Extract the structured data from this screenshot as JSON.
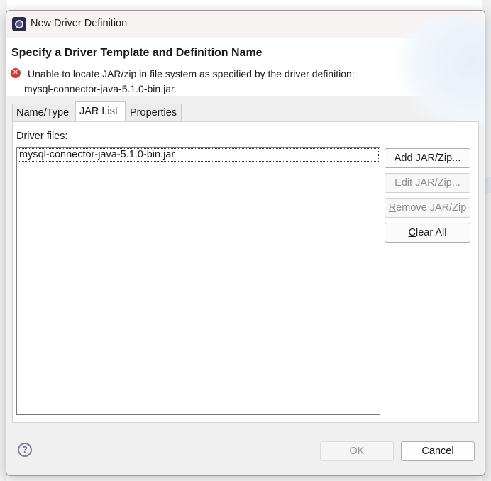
{
  "dialog": {
    "title": "New Driver Definition",
    "close_glyph": "✕",
    "icon": "eclipse-app-icon"
  },
  "header": {
    "title": "Specify a Driver Template and Definition Name",
    "error_icon": "error-x-icon",
    "error_line1": "Unable to locate JAR/zip in file system as specified by the driver definition:",
    "error_line2": "mysql-connector-java-5.1.0-bin.jar."
  },
  "tabs": [
    {
      "label": "Name/Type",
      "active": false
    },
    {
      "label": "JAR List",
      "active": true
    },
    {
      "label": "Properties",
      "active": false
    }
  ],
  "jar_list": {
    "files_label_pre": "Driver ",
    "files_label_mnemonic": "f",
    "files_label_post": "iles:",
    "files": [
      "mysql-connector-java-5.1.0-bin.jar"
    ]
  },
  "buttons": {
    "add": {
      "mn": "A",
      "rest": "dd JAR/Zip...",
      "enabled": true
    },
    "edit": {
      "mn": "E",
      "rest": "dit JAR/Zip...",
      "enabled": false
    },
    "remove": {
      "mn": "R",
      "rest": "emove JAR/Zip",
      "enabled": false
    },
    "clear": {
      "mn": "C",
      "rest": "lear All",
      "enabled": true
    }
  },
  "footer": {
    "help_glyph": "?",
    "ok_label": "OK",
    "cancel_label": "Cancel"
  },
  "colors": {
    "error_red": "#d33a3a",
    "disabled_text": "#8d8d8d"
  }
}
